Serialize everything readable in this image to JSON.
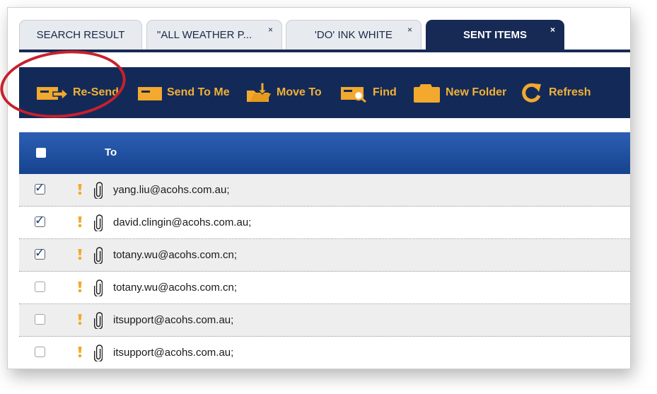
{
  "tabs": [
    {
      "label": "SEARCH RESULT",
      "closable": false,
      "active": false
    },
    {
      "label": "\"ALL WEATHER P...",
      "closable": true,
      "active": false
    },
    {
      "label": "'DO' INK WHITE",
      "closable": true,
      "active": false
    },
    {
      "label": "SENT ITEMS",
      "closable": true,
      "active": true
    }
  ],
  "tab_close_glyph": "×",
  "toolbar": {
    "resend": "Re-Send",
    "send_to_me": "Send To Me",
    "move_to": "Move To",
    "find": "Find",
    "new_folder": "New Folder",
    "refresh": "Refresh"
  },
  "table": {
    "column_to": "To",
    "rows": [
      {
        "email": "yang.liu@acohs.com.au;",
        "checked": true
      },
      {
        "email": "david.clingin@acohs.com.au;",
        "checked": true
      },
      {
        "email": "totany.wu@acohs.com.cn;",
        "checked": true
      },
      {
        "email": "totany.wu@acohs.com.cn;",
        "checked": false
      },
      {
        "email": "itsupport@acohs.com.au;",
        "checked": false
      },
      {
        "email": "itsupport@acohs.com.au;",
        "checked": false
      }
    ]
  },
  "icons": {
    "priority": "exclamation-icon",
    "attachment": "paperclip-icon"
  },
  "colors": {
    "toolbar_bg": "#132a59",
    "tool_label": "#f2b135",
    "active_tab": "#172a55",
    "header_bg": "#1f52a3",
    "annotation": "#c8202c"
  }
}
